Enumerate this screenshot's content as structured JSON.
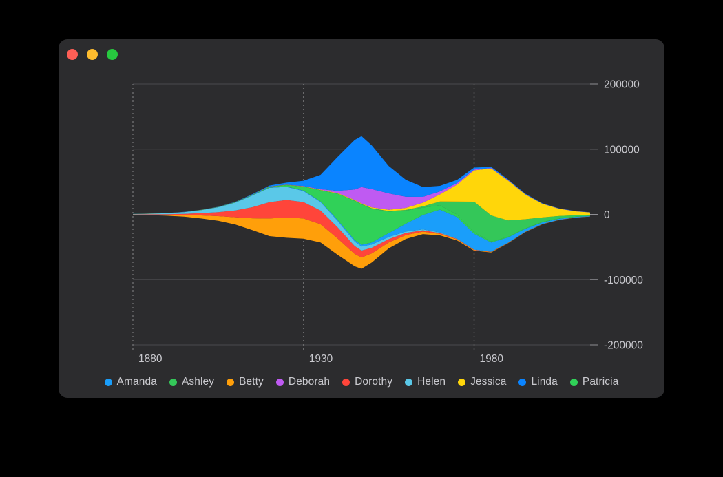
{
  "window": {
    "background_color": "#2c2c2e",
    "titlebar": {
      "close_label": "",
      "minimize_label": "",
      "maximize_label": "",
      "close_color": "#ff5f56",
      "minimize_color": "#ffbd2e",
      "maximize_color": "#27c93f"
    }
  },
  "chart_data": {
    "type": "area",
    "variant": "streamgraph",
    "title": "",
    "subtitle": "",
    "xlabel": "",
    "ylabel": "",
    "offset": "wiggle",
    "grid": {
      "horizontal": true,
      "vertical": true,
      "vertical_style": "dotted",
      "horizontal_color": "#4a4a4d",
      "vertical_color": "#6e6e70"
    },
    "legend_position": "bottom",
    "xlim": [
      1880,
      2014
    ],
    "ylim": [
      -200000,
      200000
    ],
    "xticks": [
      1880,
      1930,
      1980
    ],
    "xticklabels": [
      "1880",
      "1930",
      "1980"
    ],
    "yticks": [
      200000,
      100000,
      0,
      -100000,
      -200000
    ],
    "yticklabels": [
      "200000",
      "100000",
      "0",
      "-100000",
      "-200000"
    ],
    "colors": {
      "Amanda": "#1a9efa",
      "Ashley": "#34c759",
      "Betty": "#ff9f0a",
      "Deborah": "#bf5af2",
      "Dorothy": "#ff453a",
      "Helen": "#5ac8e8",
      "Jessica": "#ffd60a",
      "Linda": "#0a84ff",
      "Patricia": "#30d158"
    },
    "stack_order": [
      "Betty",
      "Dorothy",
      "Helen",
      "Amanda",
      "Patricia",
      "Ashley",
      "Jessica",
      "Deborah",
      "Linda"
    ],
    "x": [
      1880,
      1885,
      1890,
      1895,
      1900,
      1905,
      1910,
      1915,
      1920,
      1925,
      1930,
      1935,
      1940,
      1945,
      1947,
      1950,
      1955,
      1960,
      1965,
      1970,
      1975,
      1980,
      1985,
      1990,
      1995,
      2000,
      2005,
      2010,
      2014
    ],
    "series": [
      {
        "name": "Amanda",
        "color": "#1a9efa",
        "values": [
          30,
          40,
          60,
          80,
          110,
          140,
          180,
          260,
          400,
          520,
          700,
          900,
          1400,
          2200,
          2600,
          3100,
          6000,
          12000,
          22000,
          35000,
          33000,
          24000,
          14000,
          8000,
          4500,
          2600,
          1500,
          900,
          600
        ]
      },
      {
        "name": "Ashley",
        "color": "#34c759",
        "values": [
          25,
          30,
          40,
          50,
          70,
          90,
          110,
          140,
          180,
          220,
          280,
          340,
          420,
          520,
          560,
          620,
          800,
          1100,
          1900,
          6000,
          20000,
          47000,
          40000,
          25000,
          14000,
          7000,
          3800,
          2100,
          1400
        ]
      },
      {
        "name": "Betty",
        "color": "#ff9f0a",
        "values": [
          400,
          700,
          1300,
          2400,
          4500,
          7000,
          11000,
          18000,
          27000,
          31000,
          31000,
          28000,
          25000,
          19000,
          17500,
          14000,
          9000,
          6000,
          3800,
          2300,
          1400,
          900,
          600,
          420,
          300,
          230,
          180,
          150,
          130
        ]
      },
      {
        "name": "Deborah",
        "color": "#bf5af2",
        "values": [
          20,
          25,
          30,
          40,
          55,
          70,
          90,
          120,
          170,
          240,
          400,
          900,
          3500,
          16000,
          25000,
          28000,
          25000,
          17000,
          9000,
          4500,
          2400,
          1400,
          900,
          600,
          420,
          300,
          230,
          180,
          150
        ]
      },
      {
        "name": "Dorothy",
        "color": "#ff453a",
        "values": [
          320,
          560,
          1000,
          1900,
          3600,
          6200,
          10500,
          17000,
          25000,
          27000,
          25000,
          21000,
          17000,
          12000,
          10500,
          8500,
          5200,
          3300,
          2100,
          1300,
          800,
          520,
          360,
          260,
          190,
          150,
          120,
          100,
          90
        ]
      },
      {
        "name": "Helen",
        "color": "#5ac8e8",
        "values": [
          560,
          900,
          1500,
          2600,
          4600,
          7400,
          12000,
          18000,
          22000,
          20000,
          17000,
          13000,
          10000,
          7000,
          6200,
          5000,
          3200,
          2100,
          1400,
          900,
          600,
          400,
          290,
          210,
          160,
          130,
          110,
          95,
          85
        ]
      },
      {
        "name": "Jessica",
        "color": "#ffd60a",
        "values": [
          30,
          35,
          45,
          60,
          80,
          100,
          130,
          170,
          230,
          300,
          400,
          520,
          700,
          950,
          1050,
          1300,
          2000,
          3200,
          5500,
          11000,
          26000,
          48000,
          72000,
          61000,
          38000,
          21000,
          11000,
          6000,
          3800
        ]
      },
      {
        "name": "Linda",
        "color": "#0a84ff",
        "values": [
          40,
          55,
          80,
          120,
          180,
          260,
          400,
          700,
          1400,
          3000,
          8000,
          22000,
          52000,
          76000,
          78000,
          67000,
          42000,
          26000,
          15000,
          8500,
          4800,
          2800,
          1700,
          1100,
          700,
          480,
          340,
          250,
          200
        ]
      },
      {
        "name": "Patricia",
        "color": "#30d158",
        "values": [
          35,
          45,
          65,
          95,
          140,
          210,
          320,
          520,
          1000,
          2200,
          6000,
          17000,
          40000,
          60000,
          62000,
          52000,
          33000,
          20000,
          11500,
          6500,
          3700,
          2200,
          1400,
          900,
          600,
          420,
          300,
          230,
          190
        ]
      }
    ]
  },
  "legend": {
    "items": [
      {
        "label": "Amanda",
        "color": "#1a9efa",
        "swatch": "circle-swatch"
      },
      {
        "label": "Ashley",
        "color": "#34c759",
        "swatch": "circle-swatch"
      },
      {
        "label": "Betty",
        "color": "#ff9f0a",
        "swatch": "circle-swatch"
      },
      {
        "label": "Deborah",
        "color": "#bf5af2",
        "swatch": "circle-swatch"
      },
      {
        "label": "Dorothy",
        "color": "#ff453a",
        "swatch": "circle-swatch"
      },
      {
        "label": "Helen",
        "color": "#5ac8e8",
        "swatch": "circle-swatch"
      },
      {
        "label": "Jessica",
        "color": "#ffd60a",
        "swatch": "circle-swatch"
      },
      {
        "label": "Linda",
        "color": "#0a84ff",
        "swatch": "circle-swatch"
      },
      {
        "label": "Patricia",
        "color": "#30d158",
        "swatch": "circle-swatch"
      }
    ]
  }
}
